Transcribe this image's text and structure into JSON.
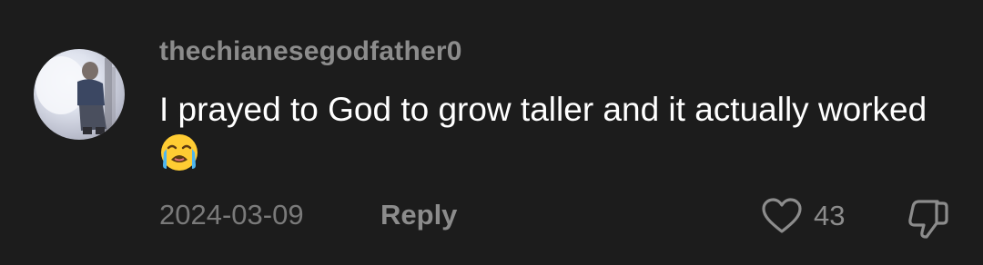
{
  "comment": {
    "username": "thechianesegodfather0",
    "text": "I prayed to God to grow taller and it actually worked",
    "emoji": "loudly-crying-face",
    "date": "2024-03-09",
    "reply_label": "Reply",
    "like_count": "43"
  },
  "icons": {
    "like": "heart-outline-icon",
    "dislike": "thumbs-down-outline-icon"
  },
  "colors": {
    "background": "#1c1c1c",
    "username": "#8c8c8c",
    "text": "#ffffff",
    "meta": "#7a7a7a"
  }
}
